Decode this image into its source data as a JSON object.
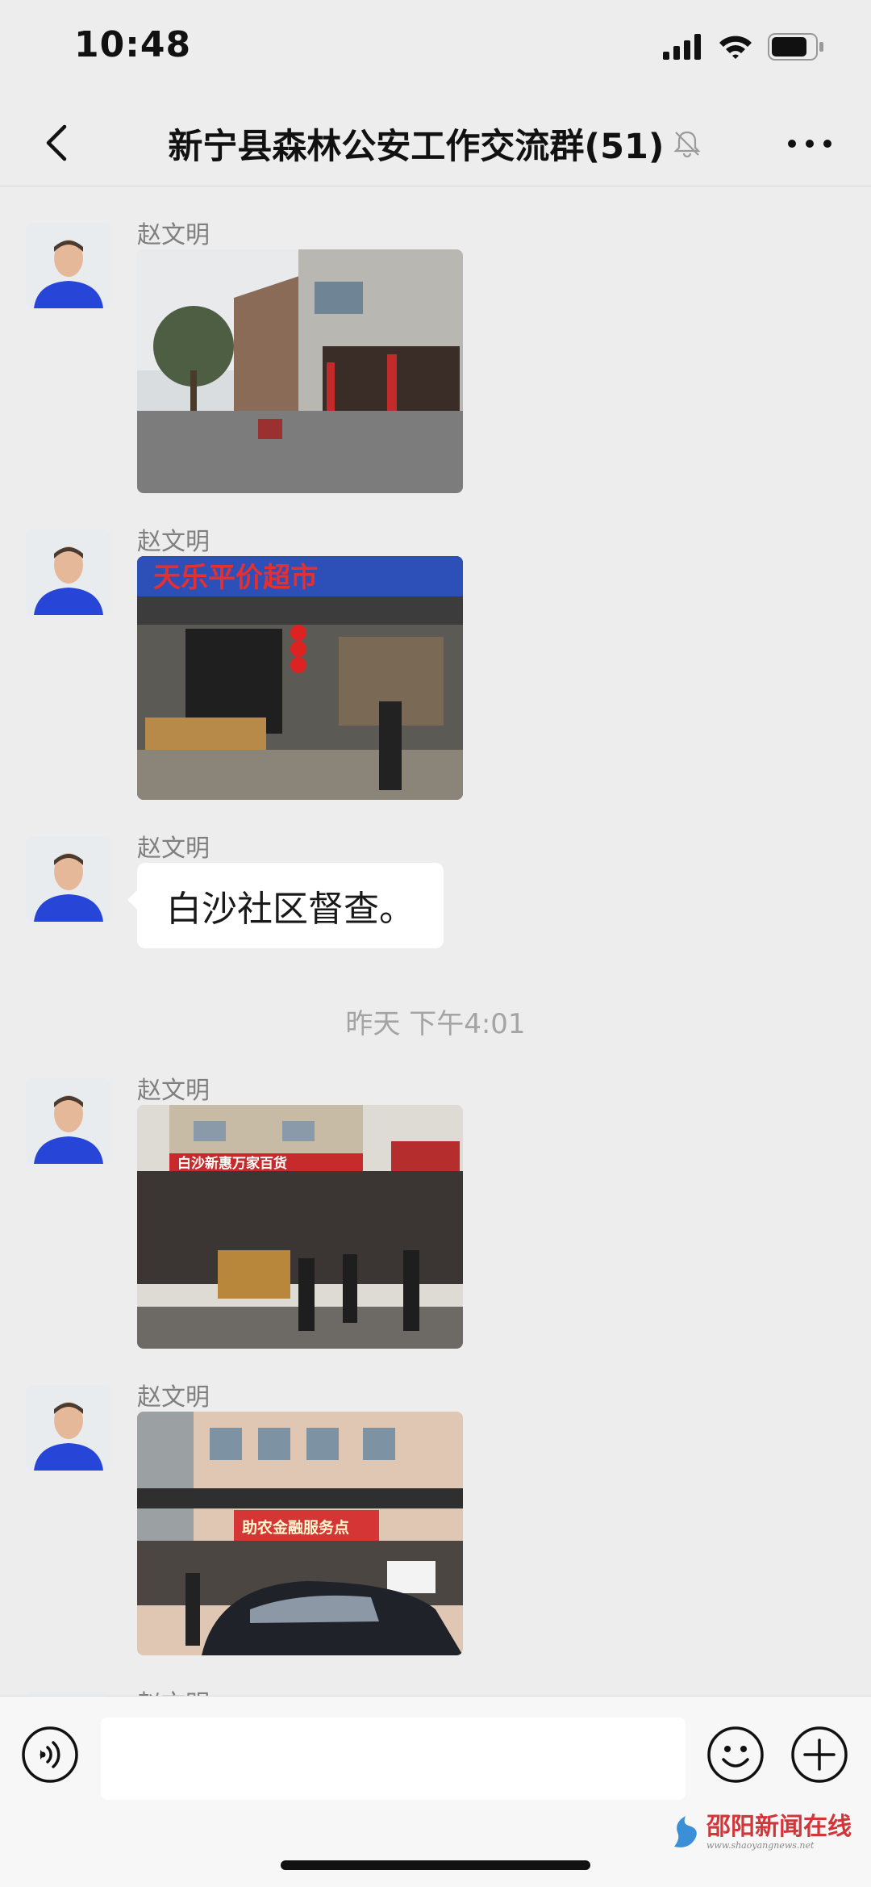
{
  "status_bar": {
    "time": "10:48",
    "battery_level": 0.82
  },
  "nav": {
    "title": "新宁县森林公安工作交流群(51)",
    "muted": true
  },
  "messages": [
    {
      "sender": "赵文明",
      "type": "image",
      "image_desc": "street-photo"
    },
    {
      "sender": "赵文明",
      "type": "image",
      "image_desc": "supermarket-photo",
      "sign_text": "天乐平价超市"
    },
    {
      "sender": "赵文明",
      "type": "text",
      "text": "白沙社区督查。"
    },
    {
      "sender": "赵文明",
      "type": "image",
      "image_desc": "storefront-photo",
      "sign_text": "白沙新惠万家百货"
    },
    {
      "sender": "赵文明",
      "type": "image",
      "image_desc": "building-photo",
      "sign_text": "助农金融服务点"
    },
    {
      "sender": "赵文明",
      "type": "partial"
    }
  ],
  "timestamp": "昨天 下午4:01",
  "input": {
    "value": "",
    "placeholder": ""
  },
  "watermark": {
    "text": "邵阳新闻在线",
    "sub": "www.shaoyangnews.net"
  },
  "colors": {
    "background": "#ededed",
    "bubble": "#ffffff",
    "sender": "#7f7f7f",
    "watermark": "#d2363a"
  }
}
